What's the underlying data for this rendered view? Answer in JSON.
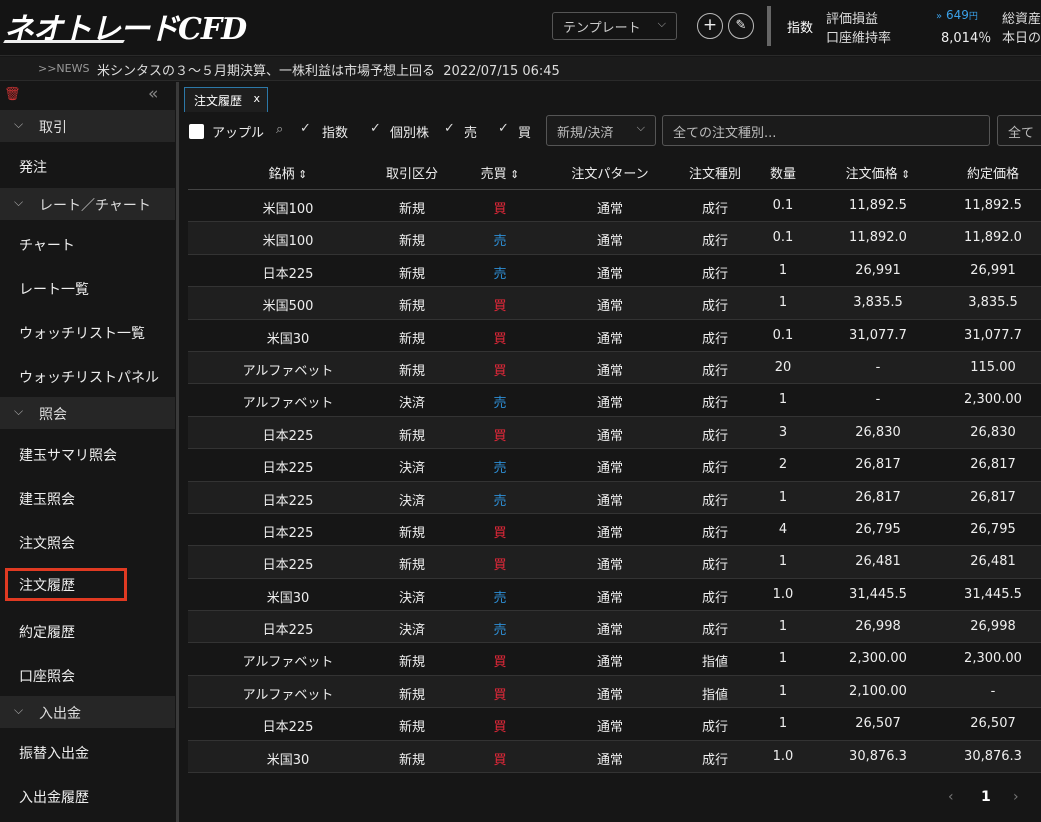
{
  "header": {
    "logo": "ネオトレードCFD",
    "template_label": "テンプレート",
    "add_symbol": "+",
    "edit_symbol": "✎",
    "index_label": "指数",
    "pnl_label": "評価損益",
    "margin_label": "口座維持率",
    "pnl_value": "649",
    "pnl_unit": "円",
    "margin_value": "8,014％",
    "total_label": "総資産",
    "today_label": "本日の"
  },
  "news": {
    "tag": ">>NEWS",
    "headline": "米シンタスの３～５月期決算、一株利益は市場予想上回る",
    "timestamp": "2022/07/15 06:45"
  },
  "sidebar": {
    "sections": [
      {
        "label": "取引",
        "items": [
          "発注"
        ]
      },
      {
        "label": "レート／チャート",
        "items": [
          "チャート",
          "レート一覧",
          "ウォッチリスト一覧",
          "ウォッチリストパネル"
        ]
      },
      {
        "label": "照会",
        "items": [
          "建玉サマリ照会",
          "建玉照会",
          "注文照会",
          "注文履歴",
          "約定履歴",
          "口座照会"
        ]
      },
      {
        "label": "入出金",
        "items": [
          "振替入出金",
          "入出金履歴"
        ]
      }
    ],
    "active_item": "注文履歴"
  },
  "tab": {
    "label": "注文履歴",
    "close": "x"
  },
  "filters": {
    "apple_label": "アップル",
    "index_label": "指数",
    "stock_label": "個別株",
    "sell_label": "売",
    "buy_label": "買",
    "kind_select": "新規/決済",
    "order_type_select": "全ての注文種別...",
    "third_select": "全て"
  },
  "table": {
    "columns": [
      "銘柄",
      "取引区分",
      "売買",
      "注文パターン",
      "注文種別",
      "数量",
      "注文価格",
      "約定価格"
    ],
    "rows": [
      [
        "米国100",
        "新規",
        "買",
        "通常",
        "成行",
        "0.1",
        "11,892.5",
        "11,892.5"
      ],
      [
        "米国100",
        "新規",
        "売",
        "通常",
        "成行",
        "0.1",
        "11,892.0",
        "11,892.0"
      ],
      [
        "日本225",
        "新規",
        "売",
        "通常",
        "成行",
        "1",
        "26,991",
        "26,991"
      ],
      [
        "米国500",
        "新規",
        "買",
        "通常",
        "成行",
        "1",
        "3,835.5",
        "3,835.5"
      ],
      [
        "米国30",
        "新規",
        "買",
        "通常",
        "成行",
        "0.1",
        "31,077.7",
        "31,077.7"
      ],
      [
        "アルファベット",
        "新規",
        "買",
        "通常",
        "成行",
        "20",
        "-",
        "115.00"
      ],
      [
        "アルファベット",
        "決済",
        "売",
        "通常",
        "成行",
        "1",
        "-",
        "2,300.00"
      ],
      [
        "日本225",
        "新規",
        "買",
        "通常",
        "成行",
        "3",
        "26,830",
        "26,830"
      ],
      [
        "日本225",
        "決済",
        "売",
        "通常",
        "成行",
        "2",
        "26,817",
        "26,817"
      ],
      [
        "日本225",
        "決済",
        "売",
        "通常",
        "成行",
        "1",
        "26,817",
        "26,817"
      ],
      [
        "日本225",
        "新規",
        "買",
        "通常",
        "成行",
        "4",
        "26,795",
        "26,795"
      ],
      [
        "日本225",
        "新規",
        "買",
        "通常",
        "成行",
        "1",
        "26,481",
        "26,481"
      ],
      [
        "米国30",
        "決済",
        "売",
        "通常",
        "成行",
        "1.0",
        "31,445.5",
        "31,445.5"
      ],
      [
        "日本225",
        "決済",
        "売",
        "通常",
        "成行",
        "1",
        "26,998",
        "26,998"
      ],
      [
        "アルファベット",
        "新規",
        "買",
        "通常",
        "指値",
        "1",
        "2,300.00",
        "2,300.00"
      ],
      [
        "アルファベット",
        "新規",
        "買",
        "通常",
        "指値",
        "1",
        "2,100.00",
        "-"
      ],
      [
        "日本225",
        "新規",
        "買",
        "通常",
        "成行",
        "1",
        "26,507",
        "26,507"
      ],
      [
        "米国30",
        "新規",
        "買",
        "通常",
        "成行",
        "1.0",
        "30,876.3",
        "30,876.3"
      ]
    ]
  },
  "pager": {
    "prev": "‹",
    "page": "1",
    "next": "›"
  },
  "colors": {
    "buy": "#e8283a",
    "sell": "#2e8fd6",
    "active_outline": "#e03a22",
    "pnl_blue": "#3aa0e8"
  }
}
